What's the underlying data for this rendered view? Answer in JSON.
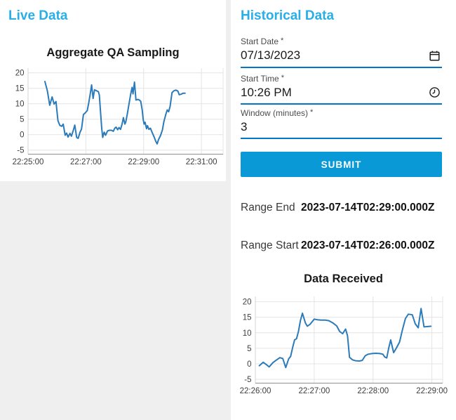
{
  "page": {
    "background": "#efefef",
    "card_background": "#ffffff"
  },
  "colors": {
    "accent_heading": "#29aee8",
    "submit_button": "#0899d6",
    "field_underline": "#0077c9",
    "chart_line": "#2b7bba"
  },
  "live_panel": {
    "title": "Live Data"
  },
  "historical_panel": {
    "title": "Historical Data",
    "fields": [
      {
        "label": "Start Date",
        "required_mark": "*",
        "value": "07/13/2023",
        "icon": "calendar-icon"
      },
      {
        "label": "Start Time",
        "required_mark": "*",
        "value": "10:26 PM",
        "icon": "clock-icon"
      },
      {
        "label": "Window (minutes)",
        "required_mark": "*",
        "value": "3",
        "icon": null
      }
    ],
    "submit_label": "SUBMIT",
    "results": [
      {
        "label": "Range End",
        "value": "2023-07-14T02:29:00.000Z"
      },
      {
        "label": "Range Start",
        "value": "2023-07-14T02:26:00.000Z"
      }
    ]
  },
  "chart_data": [
    {
      "type": "line",
      "title": "Aggregate QA Sampling",
      "x_unit": "seconds after 22:25:00",
      "xlim": [
        0,
        405
      ],
      "ylim": [
        -6.5,
        21.5
      ],
      "grid": true,
      "legend": "none",
      "x_ticks": [
        {
          "t": 0,
          "label": "22:25:00"
        },
        {
          "t": 120,
          "label": "22:27:00"
        },
        {
          "t": 240,
          "label": "22:29:00"
        },
        {
          "t": 360,
          "label": "22:31:00"
        }
      ],
      "y_ticks": [
        -5,
        0,
        5,
        10,
        15,
        20
      ],
      "points": [
        [
          35,
          17.2
        ],
        [
          40,
          14.2
        ],
        [
          45,
          9.5
        ],
        [
          50,
          12.2
        ],
        [
          54,
          9.9
        ],
        [
          58,
          10.7
        ],
        [
          62,
          4.5
        ],
        [
          66,
          3.0
        ],
        [
          70,
          2.7
        ],
        [
          73,
          3.4
        ],
        [
          77,
          -0.2
        ],
        [
          80,
          0.5
        ],
        [
          83,
          -0.8
        ],
        [
          87,
          0.4
        ],
        [
          90,
          -0.5
        ],
        [
          94,
          1.4
        ],
        [
          97,
          3.1
        ],
        [
          101,
          -0.9
        ],
        [
          104,
          -1.2
        ],
        [
          108,
          0.8
        ],
        [
          111,
          1.8
        ],
        [
          115,
          6.5
        ],
        [
          119,
          7.1
        ],
        [
          123,
          7.8
        ],
        [
          126,
          10.3
        ],
        [
          129,
          13.0
        ],
        [
          132,
          16.1
        ],
        [
          135,
          11.7
        ],
        [
          138,
          14.5
        ],
        [
          142,
          14.2
        ],
        [
          146,
          13.9
        ],
        [
          148,
          12.8
        ],
        [
          150,
          8.3
        ],
        [
          153,
          2.0
        ],
        [
          155,
          -0.9
        ],
        [
          158,
          0.8
        ],
        [
          161,
          -0.2
        ],
        [
          165,
          1.2
        ],
        [
          169,
          1.4
        ],
        [
          173,
          1.4
        ],
        [
          177,
          1.1
        ],
        [
          180,
          2.1
        ],
        [
          183,
          2.4
        ],
        [
          186,
          1.6
        ],
        [
          189,
          2.3
        ],
        [
          192,
          1.7
        ],
        [
          195,
          3.3
        ],
        [
          198,
          5.5
        ],
        [
          201,
          3.4
        ],
        [
          203,
          4.1
        ],
        [
          206,
          6.6
        ],
        [
          210,
          10.2
        ],
        [
          213,
          13.0
        ],
        [
          216,
          15.3
        ],
        [
          218,
          13.2
        ],
        [
          221,
          17.0
        ],
        [
          224,
          11.2
        ],
        [
          228,
          11.4
        ],
        [
          231,
          11.2
        ],
        [
          234,
          10.8
        ],
        [
          237,
          8.0
        ],
        [
          239,
          4.9
        ],
        [
          241,
          3.4
        ],
        [
          243,
          4.0
        ],
        [
          246,
          1.9
        ],
        [
          248,
          2.9
        ],
        [
          251,
          1.7
        ],
        [
          254,
          2.1
        ],
        [
          258,
          0.6
        ],
        [
          262,
          -0.8
        ],
        [
          265,
          -2.1
        ],
        [
          268,
          -3.0
        ],
        [
          271,
          -1.6
        ],
        [
          275,
          -0.3
        ],
        [
          279,
          1.5
        ],
        [
          282,
          4.2
        ],
        [
          286,
          6.5
        ],
        [
          289,
          8.0
        ],
        [
          292,
          7.4
        ],
        [
          295,
          9.2
        ],
        [
          299,
          13.6
        ],
        [
          303,
          14.2
        ],
        [
          307,
          14.4
        ],
        [
          311,
          14.1
        ],
        [
          314,
          12.9
        ],
        [
          318,
          13.1
        ],
        [
          322,
          13.4
        ],
        [
          326,
          13.4
        ]
      ]
    },
    {
      "type": "line",
      "title": "Data Received",
      "x_unit": "seconds after 22:26:00",
      "xlim": [
        0,
        191
      ],
      "ylim": [
        -6.5,
        21.5
      ],
      "grid": true,
      "legend": "none",
      "x_ticks": [
        {
          "t": 0,
          "label": "22:26:00"
        },
        {
          "t": 60,
          "label": "22:27:00"
        },
        {
          "t": 120,
          "label": "22:28:00"
        },
        {
          "t": 180,
          "label": "22:29:00"
        }
      ],
      "y_ticks": [
        -5,
        0,
        5,
        10,
        15,
        20
      ],
      "points": [
        [
          4,
          -0.6
        ],
        [
          8,
          0.5
        ],
        [
          11,
          -0.2
        ],
        [
          14,
          -1.0
        ],
        [
          18,
          0.4
        ],
        [
          21,
          1.1
        ],
        [
          25,
          2.0
        ],
        [
          28,
          1.7
        ],
        [
          31,
          -1.2
        ],
        [
          34,
          1.6
        ],
        [
          36,
          2.4
        ],
        [
          38,
          5.2
        ],
        [
          40,
          7.7
        ],
        [
          42,
          8.1
        ],
        [
          44,
          10.5
        ],
        [
          46,
          14.0
        ],
        [
          48,
          16.3
        ],
        [
          51,
          13.2
        ],
        [
          53,
          12.1
        ],
        [
          56,
          12.8
        ],
        [
          60,
          14.4
        ],
        [
          63,
          14.2
        ],
        [
          67,
          14.1
        ],
        [
          71,
          14.1
        ],
        [
          75,
          13.9
        ],
        [
          79,
          13.2
        ],
        [
          83,
          12.2
        ],
        [
          86,
          10.4
        ],
        [
          89,
          9.7
        ],
        [
          92,
          11.2
        ],
        [
          94,
          9.0
        ],
        [
          96,
          2.1
        ],
        [
          99,
          1.3
        ],
        [
          102,
          1.0
        ],
        [
          106,
          0.9
        ],
        [
          109,
          1.1
        ],
        [
          112,
          2.6
        ],
        [
          115,
          3.1
        ],
        [
          119,
          3.3
        ],
        [
          123,
          3.4
        ],
        [
          127,
          3.3
        ],
        [
          130,
          3.1
        ],
        [
          132,
          2.2
        ],
        [
          134,
          1.9
        ],
        [
          136,
          5.1
        ],
        [
          138,
          7.7
        ],
        [
          141,
          3.6
        ],
        [
          144,
          5.2
        ],
        [
          147,
          7.0
        ],
        [
          150,
          11.0
        ],
        [
          153,
          14.6
        ],
        [
          156,
          16.0
        ],
        [
          160,
          15.8
        ],
        [
          163,
          12.9
        ],
        [
          166,
          11.6
        ],
        [
          169,
          17.8
        ],
        [
          172,
          11.9
        ],
        [
          175,
          12.0
        ],
        [
          179,
          12.1
        ]
      ]
    }
  ]
}
